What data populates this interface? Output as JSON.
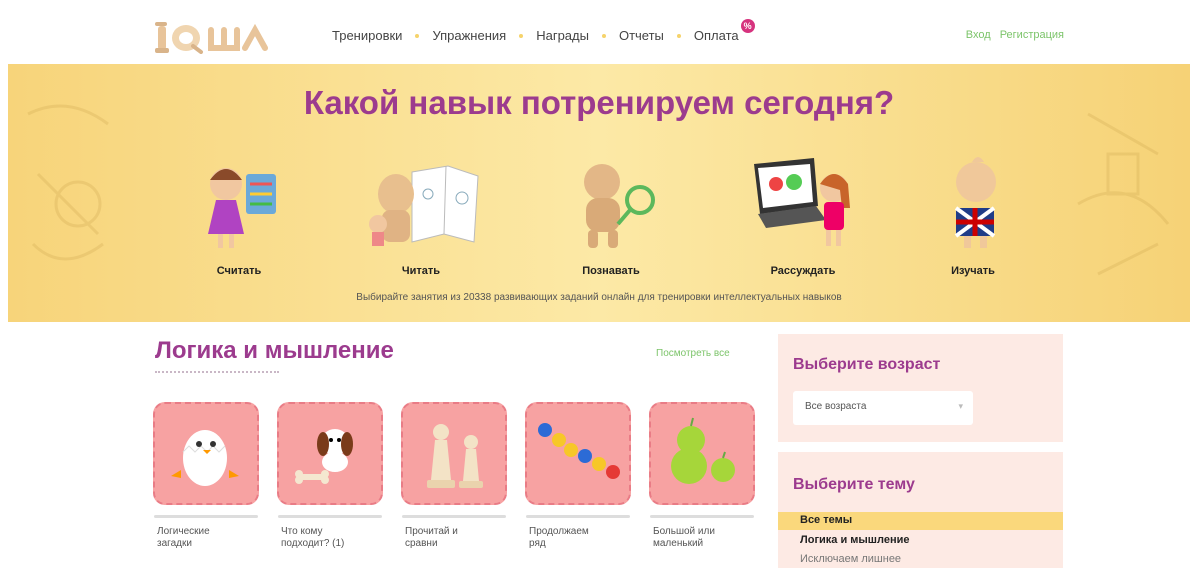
{
  "header": {
    "logo_text": "IQша",
    "nav": [
      "Тренировки",
      "Упражнения",
      "Награды",
      "Отчеты",
      "Оплата"
    ],
    "pay_badge": "%",
    "auth": {
      "login": "Вход",
      "register": "Регистрация"
    }
  },
  "banner": {
    "title": "Какой навык потренируем сегодня?",
    "skills": [
      "Считать",
      "Читать",
      "Познавать",
      "Рассуждать",
      "Изучать"
    ],
    "subtitle": "Выбирайте занятия из 20338 развивающих заданий онлайн для тренировки интеллектуальных навыков"
  },
  "section": {
    "title": "Логика и мышление",
    "see_all": "Посмотреть все",
    "cards": [
      {
        "label": "Логические загадки",
        "icon": "chick-in-egg-icon"
      },
      {
        "label": "Что кому подходит? (1)",
        "icon": "puppy-with-bone-icon"
      },
      {
        "label": "Прочитай и сравни",
        "icon": "chess-pawns-icon"
      },
      {
        "label": "Продолжаем ряд",
        "icon": "beads-row-icon"
      },
      {
        "label": "Большой или маленький",
        "icon": "apples-icon"
      }
    ]
  },
  "sidebar": {
    "age_title": "Выберите возраст",
    "age_value": "Все возраста",
    "theme_title": "Выберите тему",
    "themes": [
      "Все темы",
      "Логика и мышление",
      "Исключаем лишнее"
    ]
  },
  "colors": {
    "accent": "#9c3b8e",
    "link": "#7cc46a",
    "banner": "#f7d47a",
    "card": "#f7a2a2"
  }
}
